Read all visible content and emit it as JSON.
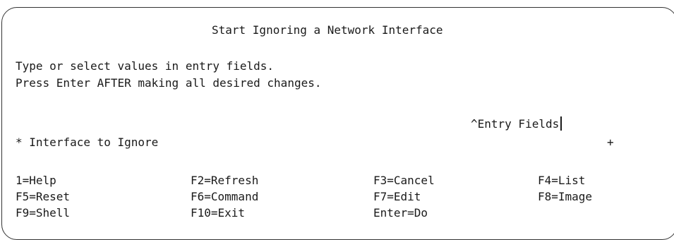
{
  "screen": {
    "title": "Start Ignoring a Network Interface",
    "instructions": [
      "Type or select values in entry fields.",
      "Press Enter AFTER making all desired changes."
    ],
    "entry_fields_header": "^Entry Fields"
  },
  "fields": [
    {
      "required_marker": "*",
      "label": "Interface to Ignore",
      "value": "",
      "list_indicator": "+"
    }
  ],
  "function_keys": [
    [
      "1=Help",
      "F2=Refresh",
      "F3=Cancel",
      "F4=List"
    ],
    [
      "F5=Reset",
      "F6=Command",
      "F7=Edit",
      "F8=Image"
    ],
    [
      "F9=Shell",
      "F10=Exit",
      "Enter=Do"
    ]
  ]
}
